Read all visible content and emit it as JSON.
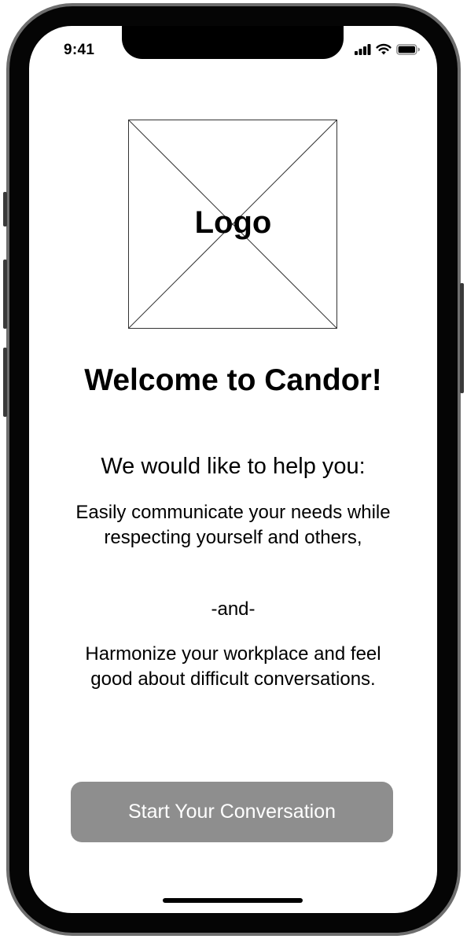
{
  "status_bar": {
    "time": "9:41"
  },
  "logo": {
    "label": "Logo"
  },
  "welcome": {
    "title": "Welcome to Candor!",
    "subtitle": "We would like to help you:",
    "point_one": "Easily communicate your needs while respecting yourself and others,",
    "separator": "-and-",
    "point_two": "Harmonize your workplace and feel good about difficult conversations."
  },
  "actions": {
    "start_label": "Start Your Conversation"
  },
  "colors": {
    "button_bg": "#8e8e8e",
    "button_text": "#ffffff",
    "text": "#000000"
  },
  "icons": [
    "signal-icon",
    "wifi-icon",
    "battery-icon"
  ]
}
